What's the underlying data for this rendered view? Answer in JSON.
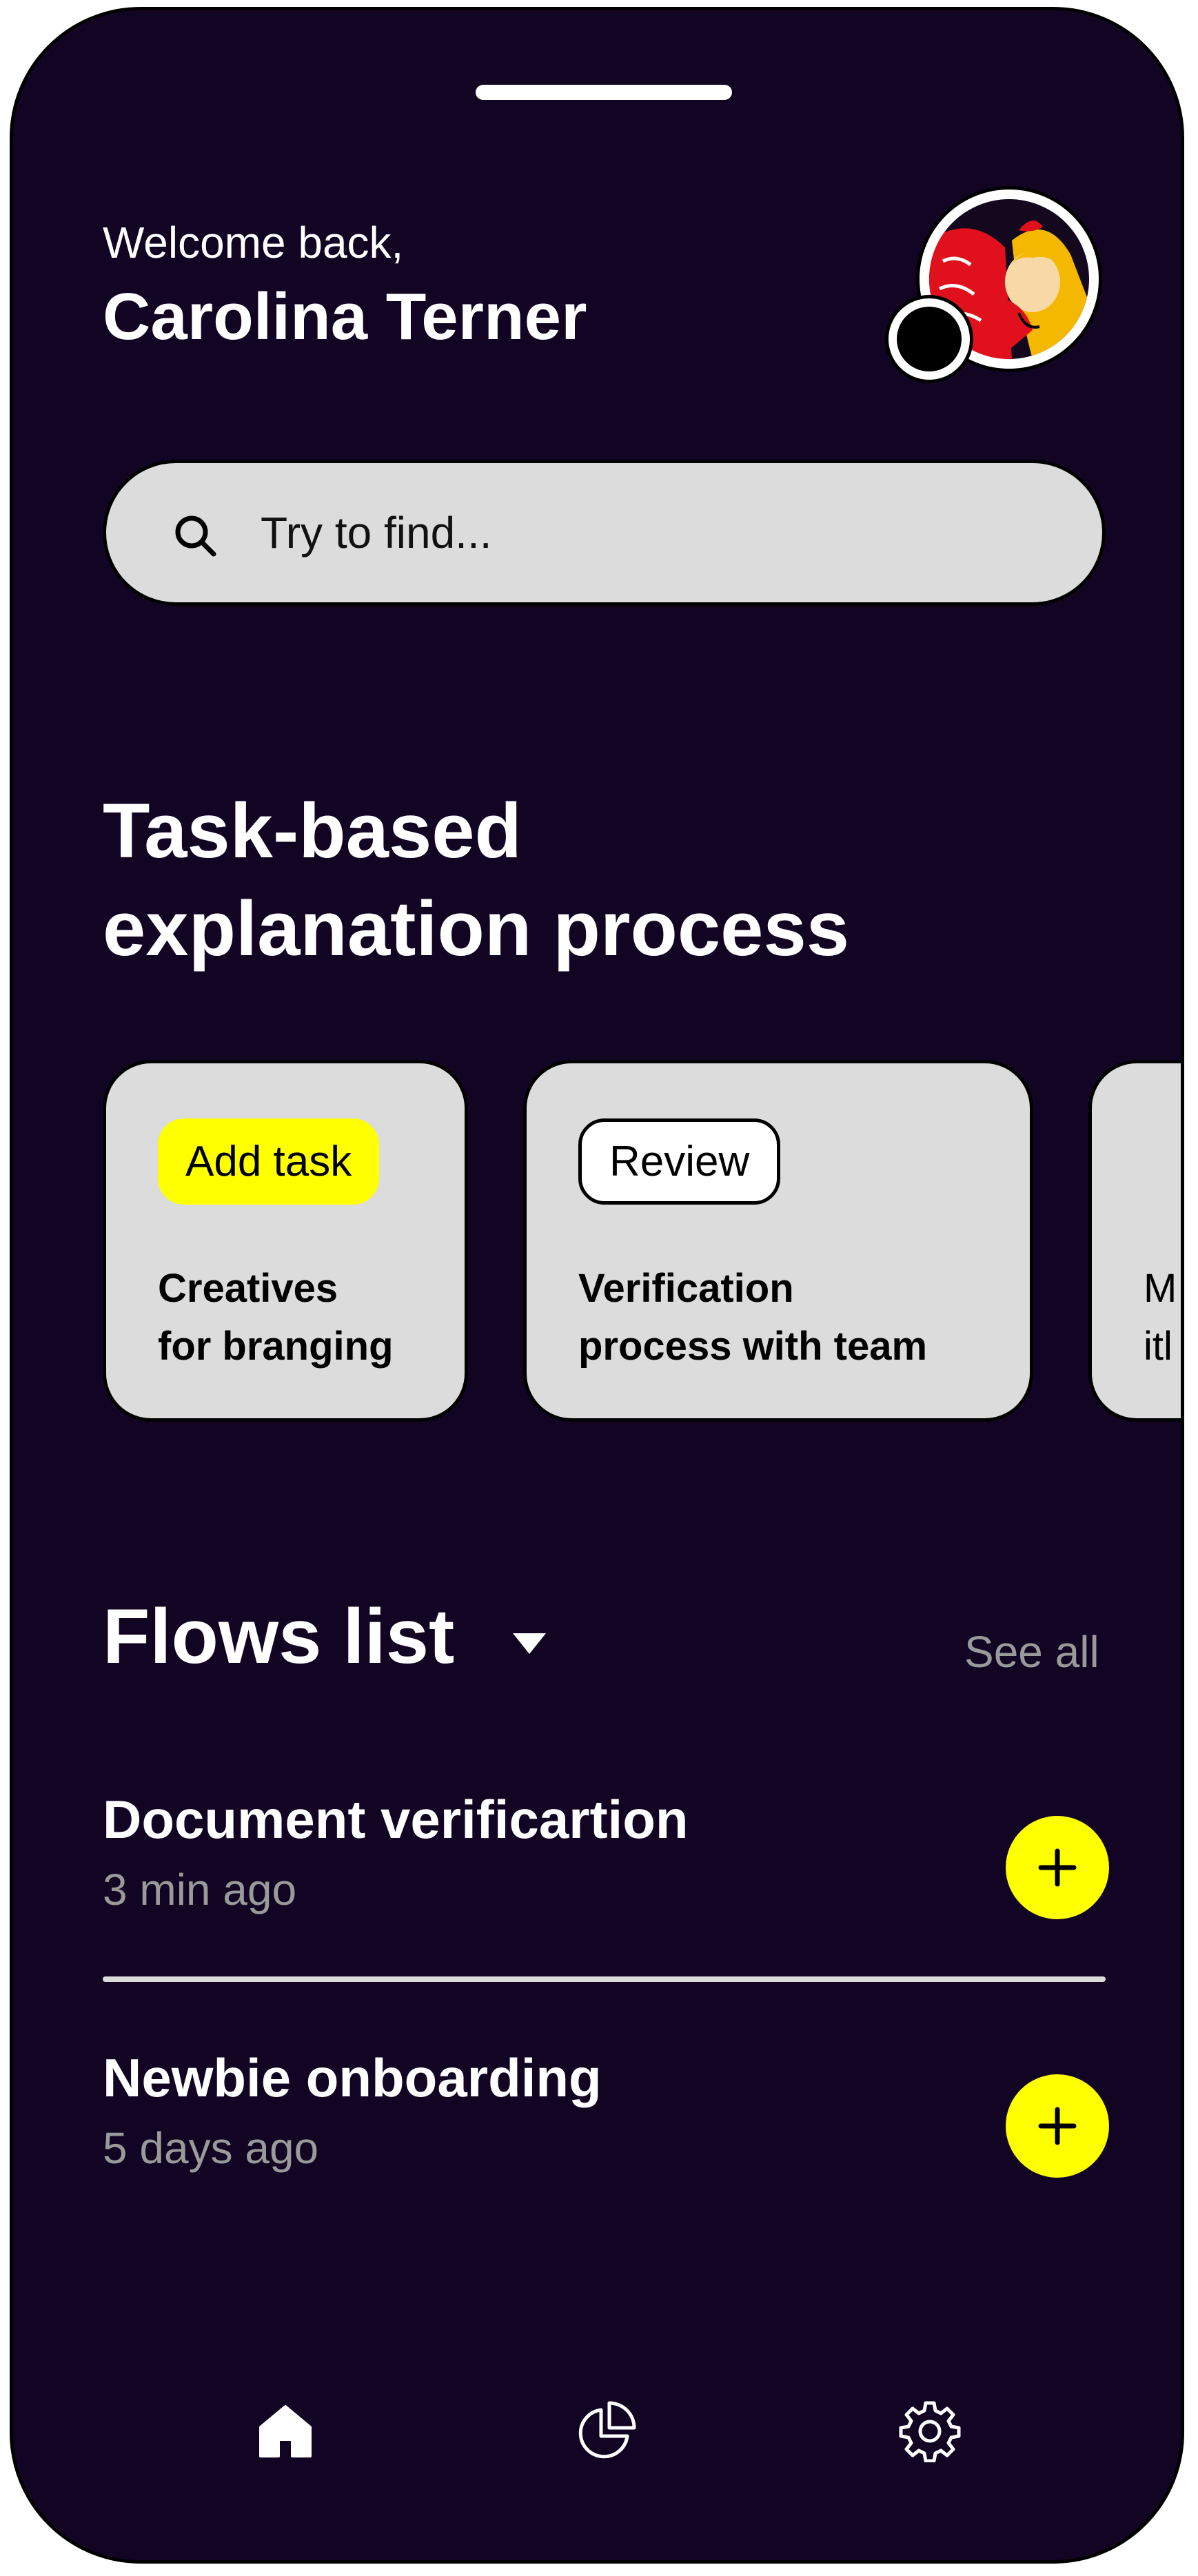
{
  "header": {
    "welcome": "Welcome back,",
    "username": "Carolina Terner"
  },
  "search": {
    "placeholder": "Try to find..."
  },
  "section": {
    "title": "Task-based\nexplanation process"
  },
  "cards": [
    {
      "tag": "Add task",
      "tag_style": "yellow",
      "text": "Creatives\nfor branging"
    },
    {
      "tag": "Review",
      "tag_style": "outline",
      "text": "Verification\nprocess with team"
    },
    {
      "tag": "",
      "tag_style": "",
      "text": "M\nitl"
    }
  ],
  "flows": {
    "title": "Flows list",
    "see_all": "See all",
    "items": [
      {
        "title": "Document verificartion",
        "time": "3 min ago"
      },
      {
        "title": "Newbie onboarding",
        "time": "5 days ago"
      }
    ]
  },
  "nav": {
    "items": [
      "home-icon",
      "pie-chart-icon",
      "gear-icon"
    ],
    "active": "home-icon"
  },
  "colors": {
    "background": "#120524",
    "accent": "#ffff00",
    "card": "#dcdcdc",
    "muted_text": "#9a9a9a"
  }
}
